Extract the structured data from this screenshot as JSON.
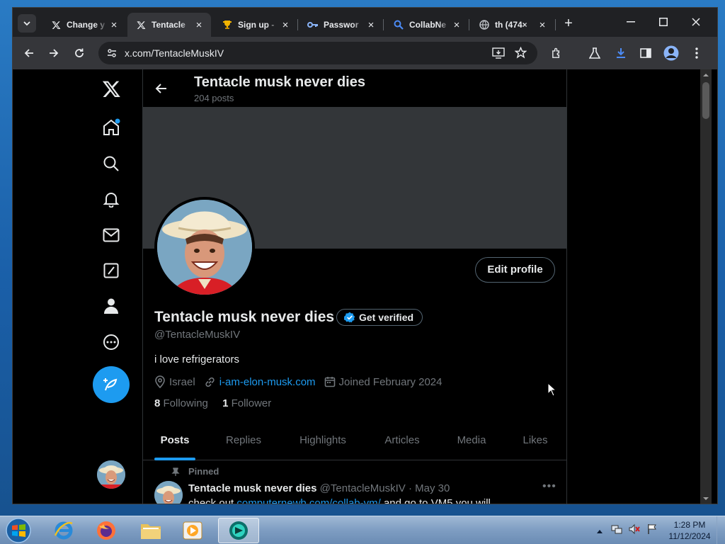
{
  "browser": {
    "tabs": [
      {
        "title": "Change y",
        "icon": "x-logo-icon"
      },
      {
        "title": "Tentacle",
        "icon": "x-logo-icon",
        "active": true
      },
      {
        "title": "Sign up -",
        "icon": "trophy-icon"
      },
      {
        "title": "Passwor",
        "icon": "key-icon"
      },
      {
        "title": "CollabNe",
        "icon": "search-icon"
      },
      {
        "title": "th (474×",
        "icon": "globe-icon"
      }
    ],
    "url": "x.com/TentacleMuskIV"
  },
  "profile": {
    "header_name": "Tentacle musk never dies",
    "post_count": "204 posts",
    "display_name": "Tentacle musk never dies",
    "get_verified": "Get verified",
    "handle": "@TentacleMuskIV",
    "bio": "i love refrigerators",
    "location": "Israel",
    "website": "i-am-elon-musk.com",
    "joined": "Joined February 2024",
    "following_count": "8",
    "following_label": "Following",
    "followers_count": "1",
    "followers_label": "Follower",
    "edit_profile": "Edit profile"
  },
  "profile_tabs": [
    "Posts",
    "Replies",
    "Highlights",
    "Articles",
    "Media",
    "Likes"
  ],
  "pinned_tweet": {
    "pinned_label": "Pinned",
    "name": "Tentacle musk never dies",
    "handle": "@TentacleMuskIV",
    "date": "· May 30",
    "text_before": "check out ",
    "link": "computernewb.com/collab-vm/",
    "text_after": " and go to VM5 you will"
  },
  "taskbar": {
    "time": "1:28 PM",
    "date": "11/12/2024"
  },
  "colors": {
    "accent": "#1d9bf0",
    "background": "#000000",
    "banner": "#333639"
  }
}
